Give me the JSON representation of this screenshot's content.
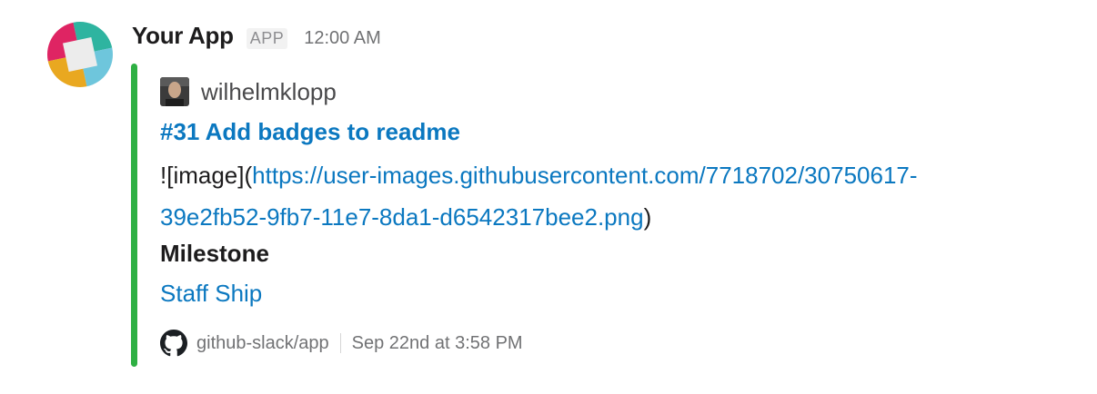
{
  "message": {
    "app_name": "Your App",
    "app_badge": "APP",
    "timestamp": "12:00 AM"
  },
  "attachment": {
    "color": "#2eb043",
    "author_name": "wilhelmklopp",
    "title": "#31 Add badges to readme",
    "body_prefix": "![image](",
    "body_link_line1": "https://user-images.githubusercontent.com/7718702/30750617-",
    "body_link_line2": "39e2fb52-9fb7-11e7-8da1-d6542317bee2.png",
    "body_suffix": ")",
    "fields": [
      {
        "title": "Milestone",
        "value": "Staff Ship"
      }
    ],
    "footer": {
      "icon": "github-icon",
      "source": "github-slack/app",
      "date": "Sep 22nd at 3:58 PM"
    }
  },
  "colors": {
    "link": "#0b78c0",
    "text": "#1d1c1d",
    "muted": "#717274"
  }
}
